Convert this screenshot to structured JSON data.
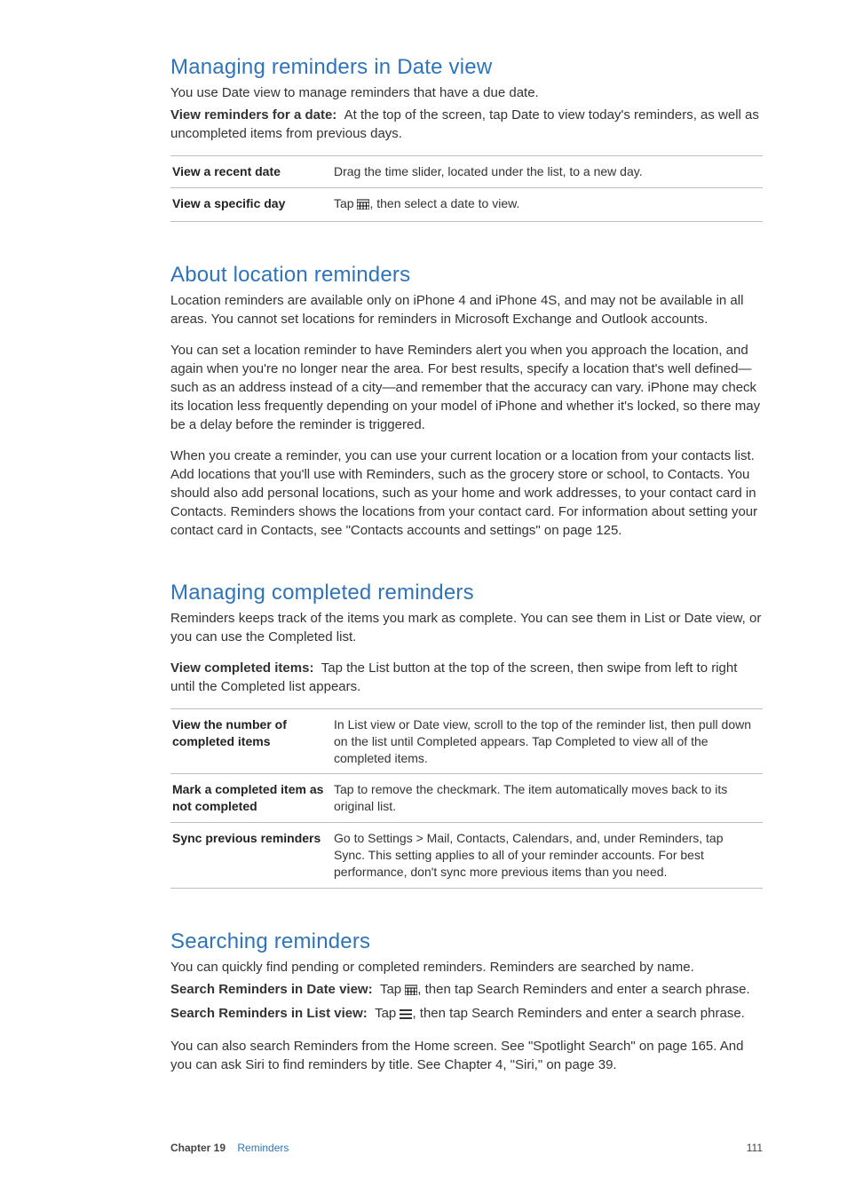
{
  "sections": {
    "managing_date_view": {
      "heading": "Managing reminders in Date view",
      "intro": "You use Date view to manage reminders that have a due date.",
      "view_for_date_label": "View reminders for a date:",
      "view_for_date_body": "At the top of the screen, tap Date to view today's reminders, as well as uncompleted items from previous days.",
      "table": [
        {
          "left": "View a recent date",
          "right": "Drag the time slider, located under the list, to a new day."
        },
        {
          "left": "View a specific day",
          "right_pre": "Tap ",
          "right_post": ", then select a date to view.",
          "icon": "calendar-icon"
        }
      ]
    },
    "about_location": {
      "heading": "About location reminders",
      "p1": "Location reminders are available only on iPhone 4 and iPhone 4S, and may not be available in all areas. You cannot set locations for reminders in Microsoft Exchange and Outlook accounts.",
      "p2": "You can set a location reminder to have Reminders alert you when you approach the location, and again when you're no longer near the area. For best results, specify a location that's well defined—such as an address instead of a city—and remember that the accuracy can vary. iPhone may check its location less frequently depending on your model of iPhone and whether it's locked, so there may be a delay before the reminder is triggered.",
      "p3": "When you create a reminder, you can use your current location or a location from your contacts list. Add locations that you'll use with Reminders, such as the grocery store or school, to Contacts. You should also add personal locations, such as your home and work addresses, to your contact card in Contacts. Reminders shows the locations from your contact card. For information about setting your contact card in Contacts, see \"Contacts accounts and settings\" on page 125."
    },
    "managing_completed": {
      "heading": "Managing completed reminders",
      "intro": "Reminders keeps track of the items you mark as complete. You can see them in List or Date view, or you can use the Completed list.",
      "view_completed_label": "View completed items:",
      "view_completed_body": "Tap the List button at the top of the screen, then swipe from left to right until the Completed list appears.",
      "table": [
        {
          "left": "View the number of completed items",
          "right": "In List view or Date view, scroll to the top of the reminder list, then pull down on the list until Completed appears. Tap Completed to view all of the completed items."
        },
        {
          "left": "Mark a completed item as not completed",
          "right": "Tap to remove the checkmark. The item automatically moves back to its original list."
        },
        {
          "left": "Sync previous reminders",
          "right": "Go to Settings > Mail, Contacts, Calendars, and, under Reminders, tap Sync. This setting applies to all of your reminder accounts. For best performance, don't sync more previous items than you need."
        }
      ]
    },
    "searching": {
      "heading": "Searching reminders",
      "intro": "You can quickly find pending or completed reminders. Reminders are searched by name.",
      "date_label": "Search Reminders in Date view:",
      "date_pre": "Tap ",
      "date_post": ", then tap Search Reminders and enter a search phrase.",
      "list_label": "Search Reminders in List view:",
      "list_pre": "Tap ",
      "list_post": ", then tap Search Reminders and enter a search phrase.",
      "outro": "You can also search Reminders from the Home screen. See \"Spotlight Search\" on page 165. And you can ask Siri to find reminders by title. See Chapter 4, \"Siri,\" on page 39."
    }
  },
  "footer": {
    "chapter": "Chapter 19",
    "title": "Reminders",
    "page": "111"
  }
}
